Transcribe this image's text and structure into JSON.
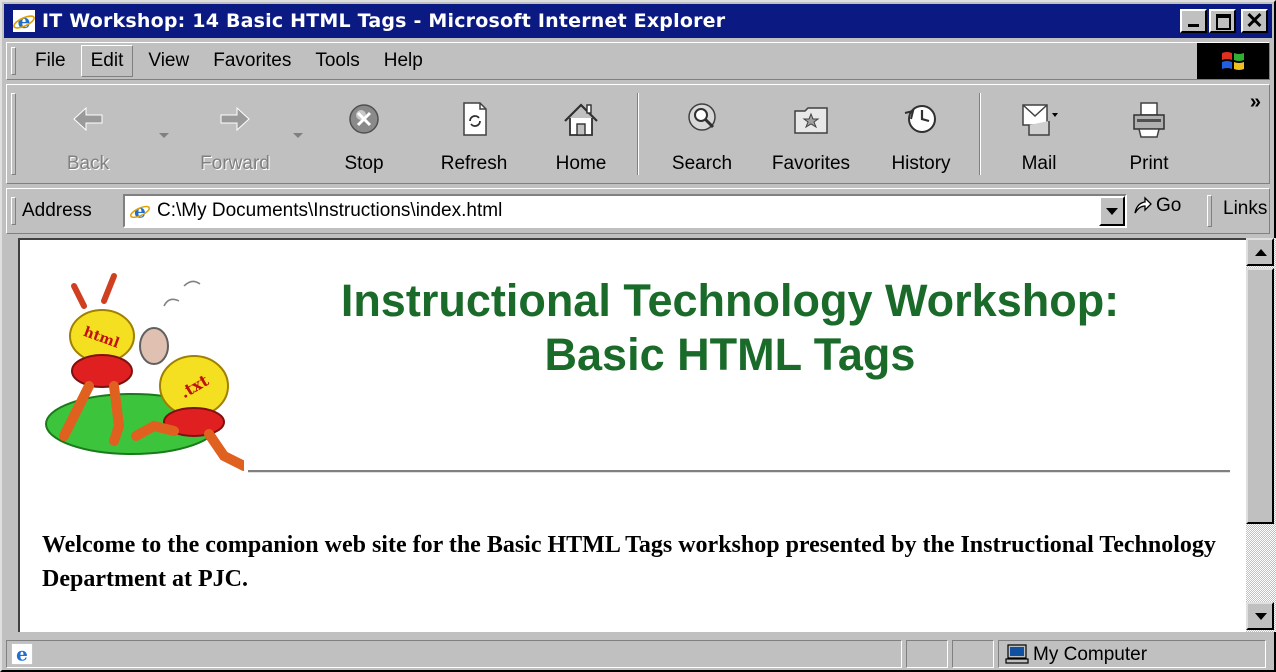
{
  "window": {
    "title": "IT Workshop: 14 Basic HTML Tags - Microsoft Internet Explorer"
  },
  "menu": {
    "items": [
      "File",
      "Edit",
      "View",
      "Favorites",
      "Tools",
      "Help"
    ]
  },
  "toolbar": {
    "back": "Back",
    "forward": "Forward",
    "stop": "Stop",
    "refresh": "Refresh",
    "home": "Home",
    "search": "Search",
    "favorites": "Favorites",
    "history": "History",
    "mail": "Mail",
    "print": "Print",
    "more": "»"
  },
  "address": {
    "label": "Address",
    "value": "C:\\My Documents\\Instructions\\index.html",
    "go": "Go",
    "links": "Links"
  },
  "page": {
    "heading_line1": "Instructional Technology Workshop:",
    "heading_line2": "Basic HTML Tags",
    "clipart_label_1": "html",
    "clipart_label_2": ".txt",
    "welcome": "Welcome to the companion web site for the Basic HTML Tags workshop presented by the Instructional Technology Department at PJC."
  },
  "status": {
    "zone": "My Computer"
  },
  "colors": {
    "title_bar": "#0a1a82",
    "heading": "#1a6a2a",
    "chrome": "#c0c0c0"
  }
}
